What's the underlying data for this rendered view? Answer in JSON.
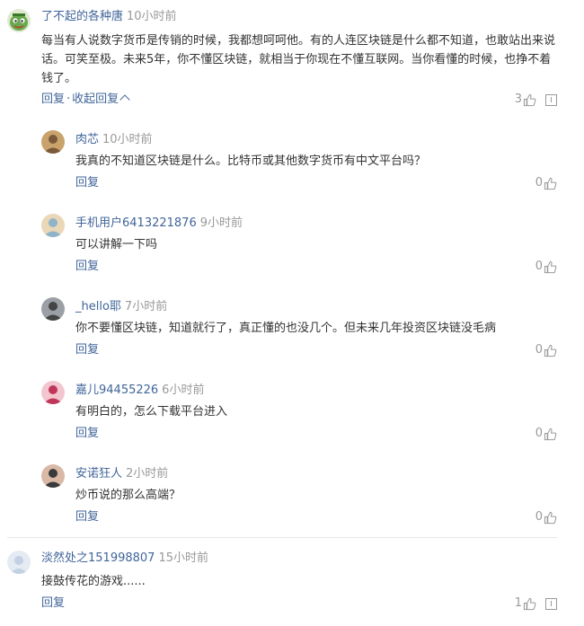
{
  "colors": {
    "username": "#406599",
    "time": "#999999",
    "text": "#333333",
    "action": "#406599"
  },
  "comments": [
    {
      "user": "了不起的各种唐",
      "time": "10小时前",
      "text_line1": "每当有人说数字货币是传销的时候，我都想呵呵他。有的人连区块链是什么都不知道，也敢站出来说",
      "text_line2": "话。可笑至极。未来5年，你不懂区块链，就相当于你现在不懂互联网。当你看懂的时候，也挣不着",
      "text_line3": "钱了。",
      "reply_label": "回复",
      "collapse_label": "收起回复",
      "separator": "·",
      "likes": "3",
      "avatar_icon": "green-cartoon-avatar-icon"
    }
  ],
  "replies": [
    {
      "user": "肉芯",
      "time": "10小时前",
      "text": "我真的不知道区块链是什么。比特币或其他数字货币有中文平台吗？",
      "reply_label": "回复",
      "likes": "0",
      "avatar_icon": "photo-avatar-icon"
    },
    {
      "user": "手机用户6413221876",
      "time": "9小时前",
      "text": "可以讲解一下吗",
      "reply_label": "回复",
      "likes": "0",
      "avatar_icon": "photo-avatar-icon"
    },
    {
      "user": "_hello耶",
      "time": "7小时前",
      "text": "你不要懂区块链，知道就行了，真正懂的也没几个。但未来几年投资区块链没毛病",
      "reply_label": "回复",
      "likes": "0",
      "avatar_icon": "photo-avatar-icon"
    },
    {
      "user": "嘉儿94455226",
      "time": "6小时前",
      "text": "有明白的，怎么下载平台进入",
      "reply_label": "回复",
      "likes": "0",
      "avatar_icon": "photo-avatar-icon"
    },
    {
      "user": "安诺狂人",
      "time": "2小时前",
      "text": "炒币说的那么高端？",
      "reply_label": "回复",
      "likes": "0",
      "avatar_icon": "photo-avatar-icon"
    }
  ],
  "last_comment": {
    "user": "淡然处之151998807",
    "time": "15小时前",
    "text": "接鼓传花的游戏......",
    "reply_label": "回复",
    "likes": "1",
    "avatar_icon": "default-avatar-icon"
  }
}
